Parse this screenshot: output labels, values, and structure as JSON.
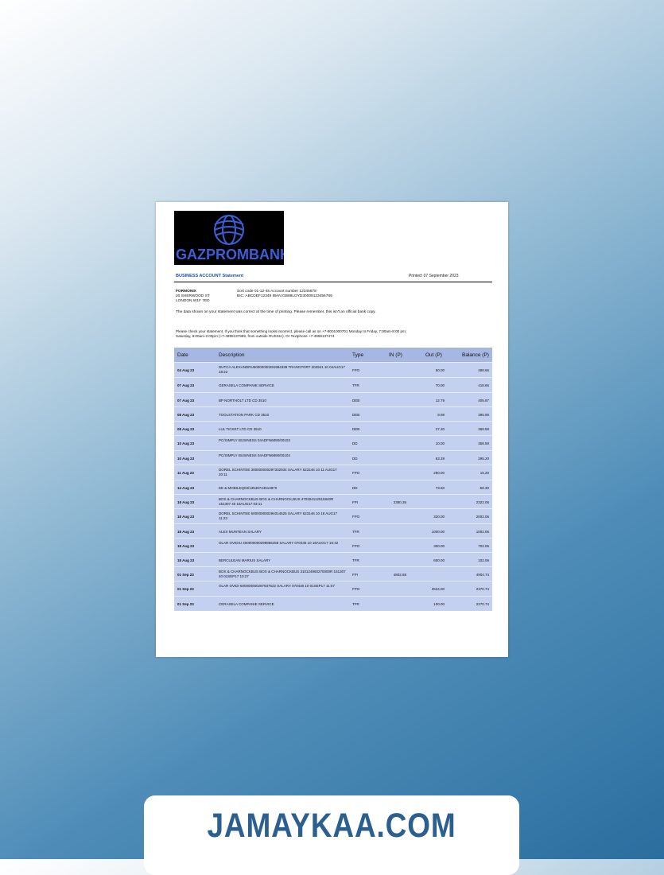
{
  "bank": {
    "name": "GAZPROMBANK"
  },
  "statement": {
    "title": "BUSINESS ACCOUNT Statement",
    "printed": "Printed: 07 September 2023"
  },
  "customer": {
    "name": "FORMONIX",
    "address1": "20 SHERWOOD ST",
    "address2": "LONDON W1F 7ED"
  },
  "account": {
    "line1": "Sort code 01-12-45  Account number 12345678",
    "line2": "BIC: ABCDEF12349   IBAN:GB88LOYD30009123456789"
  },
  "notes": {
    "data_note": "The data shown on your statement was correct at the time of printing. Please remember, this isn't an official bank copy.",
    "check_note": "Please check your statement. If you think that something looks incorrect, please call as on +7-8001000701 Monday to Friday, 7:00am-8:00 pm; Saturday, 9:00am-2:00pm (+7-4959137999, from outside RUSSIA). Or Textphone +7-4959137474"
  },
  "table": {
    "headers": {
      "date": "Date",
      "description": "Description",
      "type": "Type",
      "in": "IN (P)",
      "out": "Out (P)",
      "balance": "Balance (P)"
    },
    "rows": [
      {
        "date": "04 Aug 23",
        "desc": "DUTCA ALEXANDRU60000000291984339 TRANCPORT 202941 10 04AUG17 18:22",
        "type": "FPO",
        "in": "",
        "out": "50.00",
        "bal": "488.66"
      },
      {
        "date": "07 Aug 23",
        "desc": "GERASELA COMPANIE SERVICE",
        "type": "TFR",
        "in": "",
        "out": "70.00",
        "bal": "418.66"
      },
      {
        "date": "07 Aug 23",
        "desc": "BP NORTHOLT LTD CD 3510",
        "type": "DEB",
        "in": "",
        "out": "12.79",
        "bal": "405.87"
      },
      {
        "date": "08 Aug 23",
        "desc": "TOOLSTATION PARK CD 3510",
        "type": "DEB",
        "in": "",
        "out": "9.98",
        "bal": "395.89"
      },
      {
        "date": "08 Aug 23",
        "desc": "LUL TICKET LTD CD 3510",
        "type": "DEB",
        "in": "",
        "out": "27.30",
        "bal": "368.59"
      },
      {
        "date": "10 Aug 23",
        "desc": "PC/SIMPLY BUSINESS 04ADFN6890/00103",
        "type": "DD",
        "in": "",
        "out": "10.00",
        "bal": "358.59"
      },
      {
        "date": "10 Aug 23",
        "desc": "PC/SIMPLY BUSINESS 04ADFN6890/00104",
        "type": "DD",
        "in": "",
        "out": "63.39",
        "bal": "295.20"
      },
      {
        "date": "11 Aug 23",
        "desc": "DOREL SCHINTEE 300000000297332934 SALARY 623146 10 11 AUG17 20:11",
        "type": "FPO",
        "in": "",
        "out": "280.00",
        "bal": "15.20"
      },
      {
        "date": "14 Aug 23",
        "desc": "EE & MOBILEQ03/13548744513870",
        "type": "DD",
        "in": "",
        "out": "73.50",
        "bal": "-58.30"
      },
      {
        "date": "18 Aug 23",
        "desc": "BOX & CHARNOCKBUS BOX & CHARNOCK,BUS 470304112515940R 161307 40 18AUG17 03:11",
        "type": "FPI",
        "in": "2380.36",
        "out": "",
        "bal": "2322.06"
      },
      {
        "date": "18 Aug 23",
        "desc": "DOREL SCHINTEE 600000000294014525 SALARY 623146 10 18 AUG17 11:23",
        "type": "FPO",
        "in": "",
        "out": "320.00",
        "bal": "2002.06"
      },
      {
        "date": "18 Aug 23",
        "desc": "ALEX MUNTEAN SALARY",
        "type": "TFR",
        "in": "",
        "out": "1000.00",
        "bal": "1002.06"
      },
      {
        "date": "18 Aug 23",
        "desc": "OLAR OVIDIU 400000000299865458 SALARY 070436 10 18AUG17 16:42",
        "type": "FPO",
        "in": "",
        "out": "300.00",
        "bal": "702.06"
      },
      {
        "date": "18 Aug 23",
        "desc": "BERCULEAN MARIUS SALARY",
        "type": "TFR",
        "in": "",
        "out": "600.00",
        "bal": "102.06"
      },
      {
        "date": "01 Sep 23",
        "desc": "BOX & CHARNOCKBUS BOX & CHARNOCKBUS 310124960270000R 161307 40 01SEP17 10:27",
        "type": "FPI",
        "in": "4802.68",
        "out": "",
        "bal": "4904.74"
      },
      {
        "date": "01 Sep 23",
        "desc": "OLAR OVIDI 600000000297937622 SALARY 070436 10 01SEP17 11:07",
        "type": "FPO",
        "in": "",
        "out": "2534.00",
        "bal": "2370.74"
      },
      {
        "date": "01 Sep 23",
        "desc": "CERASELA COMPANIE SERVICE",
        "type": "TFR",
        "in": "",
        "out": "100.00",
        "bal": "2270.74"
      }
    ]
  },
  "watermark": {
    "text": "JAMAYKAA.COM"
  },
  "colors": {
    "brand": "#3a5fd8",
    "table_bg": "#c3d0f0",
    "header_bg": "#a6b7e2",
    "banner_text": "#2b5f8f"
  }
}
